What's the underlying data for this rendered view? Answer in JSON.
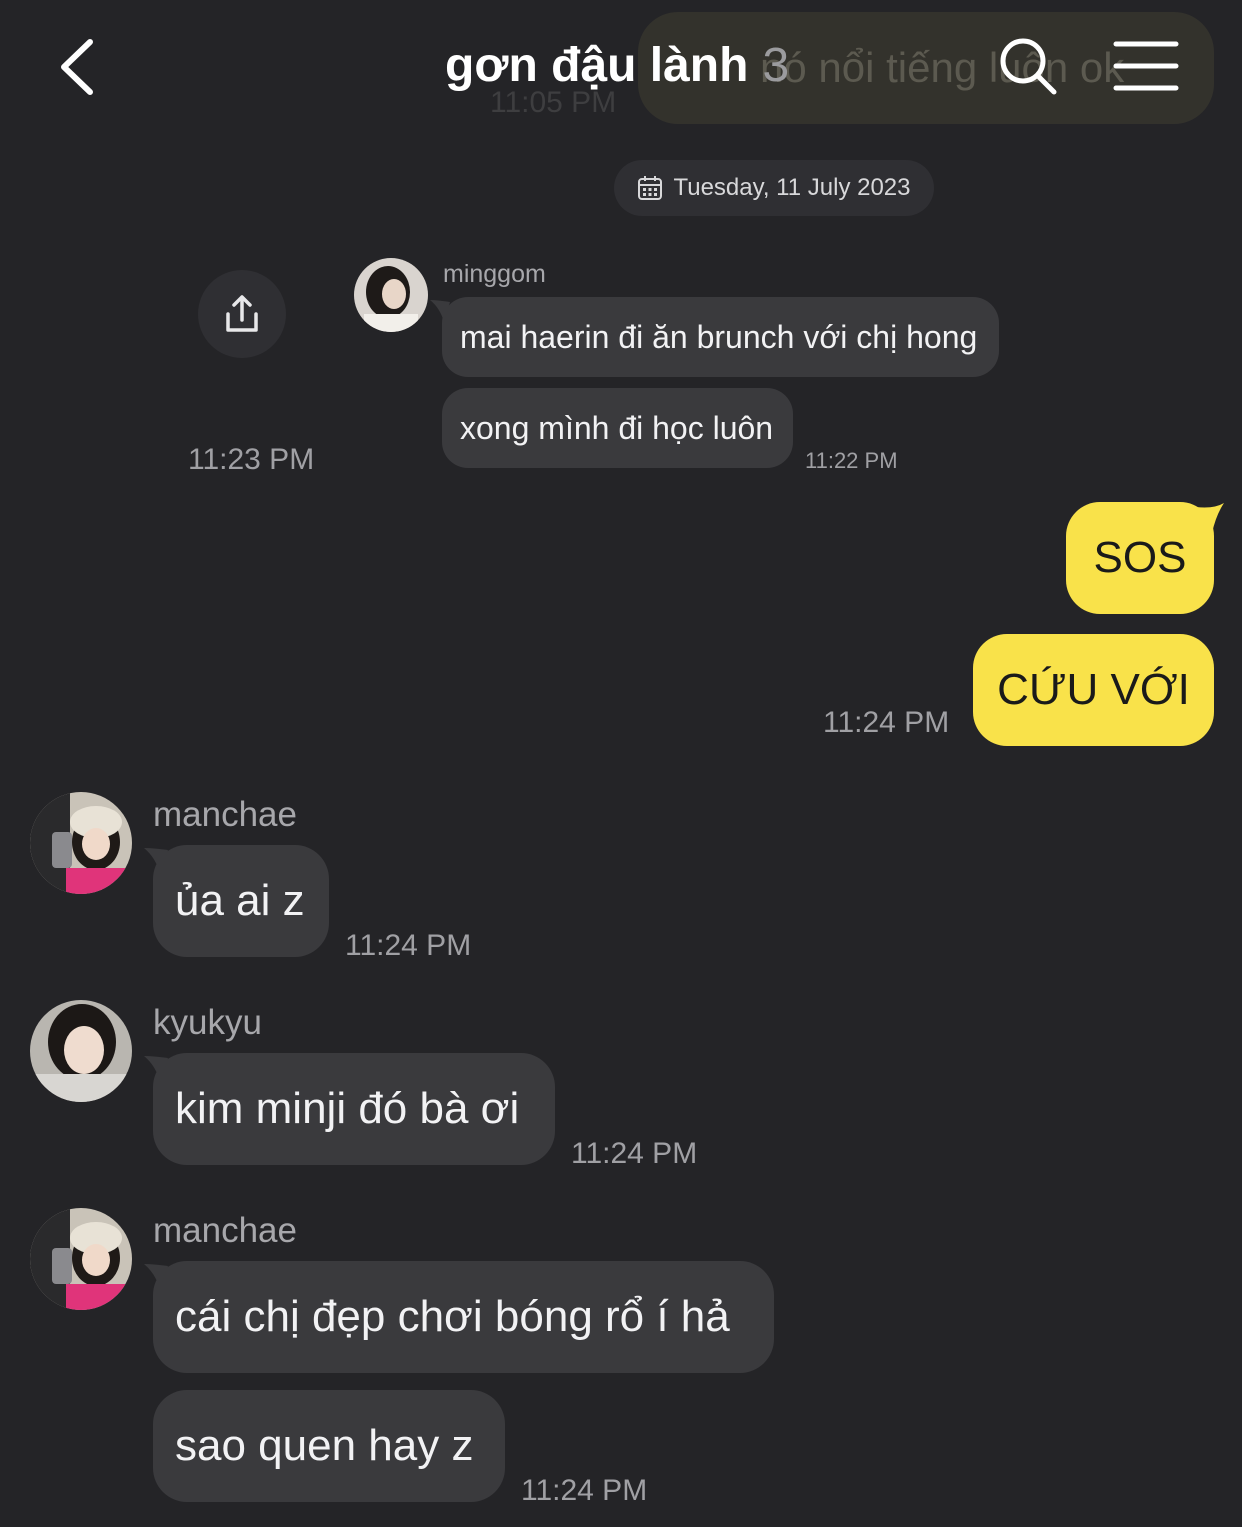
{
  "header": {
    "title": "gơn đậu lành",
    "member_count": "3",
    "back_icon": "chevron-left-icon",
    "search_icon": "search-icon",
    "menu_icon": "hamburger-menu-icon",
    "ghost_text": "nó nổi tiếng luôn ok",
    "ghost_time": "11:05 PM"
  },
  "date_divider": {
    "icon": "calendar-icon",
    "label": "Tuesday, 11 July 2023"
  },
  "share_icon": "share-icon",
  "messages": [
    {
      "sender": "minggom",
      "lines": [
        "mai haerin đi ăn brunch với chị hong",
        "xong mình đi học luôn"
      ],
      "time": "11:22 PM"
    },
    {
      "sender": "me",
      "lines": [
        "SOS",
        "CỨU VỚI"
      ],
      "time": "11:24 PM",
      "side_time": "11:23 PM"
    },
    {
      "sender": "manchae",
      "lines": [
        "ủa ai z"
      ],
      "time": "11:24 PM"
    },
    {
      "sender": "kyukyu",
      "lines": [
        "kim minji đó bà ơi"
      ],
      "time": "11:24 PM"
    },
    {
      "sender": "manchae",
      "lines": [
        "cái chị đẹp chơi bóng rổ í hả",
        "sao quen hay z"
      ],
      "time": "11:24 PM"
    }
  ],
  "colors": {
    "background": "#242427",
    "bubble_other": "#3a3a3d",
    "bubble_mine": "#f9e24a"
  }
}
